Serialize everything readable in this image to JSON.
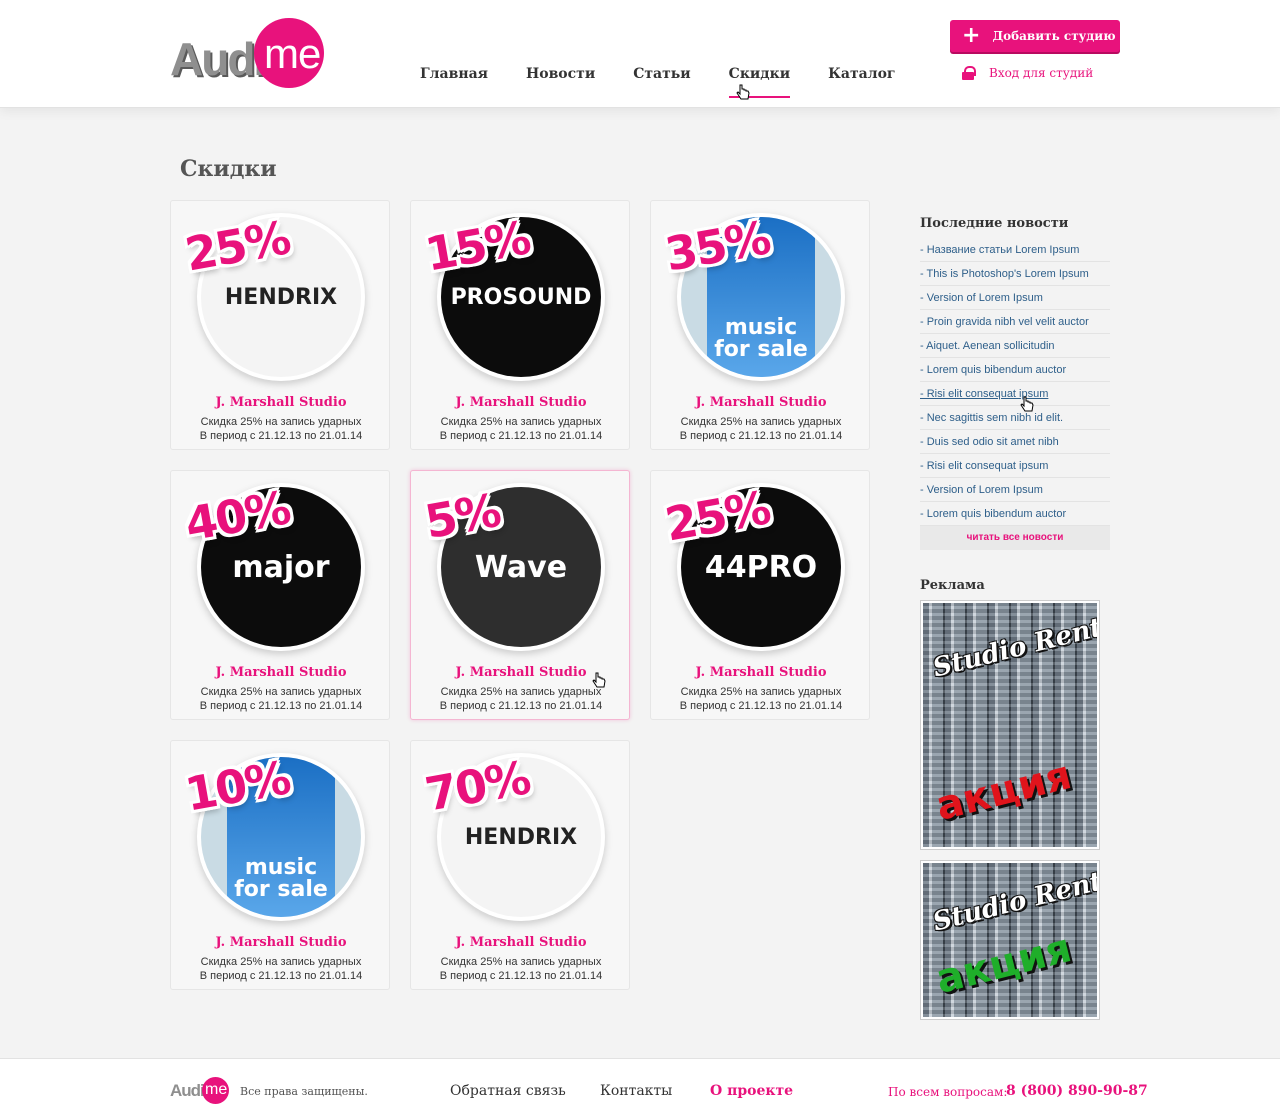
{
  "header": {
    "logo_text": "Audio",
    "logo_me": "me",
    "nav": [
      "Главная",
      "Новости",
      "Статьи",
      "Скидки",
      "Каталог"
    ],
    "active_nav": "Скидки",
    "add_button": "Добавить студию",
    "login": "Вход для студий"
  },
  "page_title": "Скидки",
  "cards": [
    {
      "percent": "25%",
      "brand": "HENDRIX",
      "style": "light",
      "title": "J. Marshall Studio",
      "line1": "Скидка 25% на запись ударных",
      "line2": "В период с 21.12.13 по 21.01.14"
    },
    {
      "percent": "15%",
      "brand": "PROSOUND",
      "style": "dark",
      "title": "J. Marshall Studio",
      "line1": "Скидка 25% на запись ударных",
      "line2": "В период с 21.12.13 по 21.01.14"
    },
    {
      "percent": "35%",
      "brand": "music for sale",
      "style": "blue",
      "title": "J. Marshall Studio",
      "line1": "Скидка 25% на запись ударных",
      "line2": "В период с 21.12.13 по 21.01.14"
    },
    {
      "percent": "40%",
      "brand": "major",
      "style": "dark",
      "title": "J. Marshall Studio",
      "line1": "Скидка 25% на запись ударных",
      "line2": "В период с 21.12.13 по 21.01.14"
    },
    {
      "percent": "5%",
      "brand": "Wave",
      "style": "gray",
      "title": "J. Marshall Studio",
      "line1": "Скидка 25% на запись ударных",
      "line2": "В период с 21.12.13 по 21.01.14"
    },
    {
      "percent": "25%",
      "brand": "44PRO",
      "style": "dark",
      "title": "J. Marshall Studio",
      "line1": "Скидка 25% на запись ударных",
      "line2": "В период с 21.12.13 по 21.01.14"
    },
    {
      "percent": "10%",
      "brand": "music for sale",
      "style": "blue",
      "title": "J. Marshall Studio",
      "line1": "Скидка 25% на запись ударных",
      "line2": "В период с 21.12.13 по 21.01.14"
    },
    {
      "percent": "70%",
      "brand": "HENDRIX",
      "style": "light",
      "title": "J. Marshall Studio",
      "line1": "Скидка 25% на запись ударных",
      "line2": "В период с 21.12.13 по 21.01.14"
    }
  ],
  "sidebar": {
    "news_title": "Последние новости",
    "news": [
      "- Название статьи Lorem Ipsum",
      "- This is Photoshop's Lorem Ipsum",
      "- Version of Lorem Ipsum",
      "- Proin gravida nibh vel velit auctor",
      "- Aiquet. Aenean sollicitudin",
      "- Lorem quis bibendum auctor",
      "- Risi elit consequat ipsum",
      "- Nec sagittis sem nibh id elit.",
      "- Duis sed odio sit amet nibh",
      "- Risi elit consequat ipsum",
      "- Version of Lorem Ipsum",
      "- Lorem quis bibendum auctor"
    ],
    "read_all": "читать все новости",
    "ads_title": "Реклама",
    "ads": [
      {
        "script": "Studio Rent",
        "promo": "акция",
        "promo_color": "#e0141c"
      },
      {
        "script": "Studio Rent",
        "promo": "акция",
        "promo_color": "#1fae2a"
      }
    ]
  },
  "footer": {
    "logo_text": "Audio",
    "logo_me": "me",
    "rights": "Все права защищены.",
    "links": [
      "Обратная связь",
      "Контакты",
      "О проекте"
    ],
    "active_link": "О проекте",
    "phone_label": "По всем вопросам:",
    "phone": "8 (800) 890-90-87"
  },
  "colors": {
    "accent": "#e8127c",
    "link": "#2e5f8a"
  }
}
